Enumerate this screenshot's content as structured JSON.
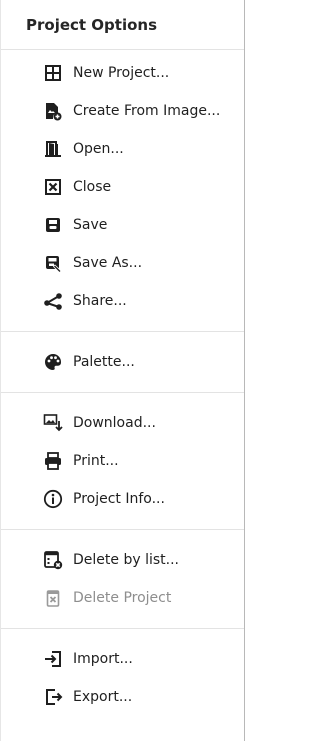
{
  "menu": {
    "title": "Project Options",
    "sections": [
      [
        {
          "label": "New Project...",
          "icon": "grid-icon",
          "enabled": true
        },
        {
          "label": "Create From Image...",
          "icon": "image-file-plus-icon",
          "enabled": true
        },
        {
          "label": "Open...",
          "icon": "door-open-icon",
          "enabled": true
        },
        {
          "label": "Close",
          "icon": "close-box-icon",
          "enabled": true
        },
        {
          "label": "Save",
          "icon": "save-icon",
          "enabled": true
        },
        {
          "label": "Save As...",
          "icon": "save-as-icon",
          "enabled": true
        },
        {
          "label": "Share...",
          "icon": "share-icon",
          "enabled": true
        }
      ],
      [
        {
          "label": "Palette...",
          "icon": "palette-icon",
          "enabled": true
        }
      ],
      [
        {
          "label": "Download...",
          "icon": "download-image-icon",
          "enabled": true
        },
        {
          "label": "Print...",
          "icon": "printer-icon",
          "enabled": true
        },
        {
          "label": "Project Info...",
          "icon": "info-icon",
          "enabled": true
        }
      ],
      [
        {
          "label": "Delete by list...",
          "icon": "delete-list-icon",
          "enabled": true
        },
        {
          "label": "Delete Project",
          "icon": "delete-project-icon",
          "enabled": false
        }
      ],
      [
        {
          "label": "Import...",
          "icon": "import-icon",
          "enabled": true
        },
        {
          "label": "Export...",
          "icon": "export-icon",
          "enabled": true
        }
      ]
    ]
  },
  "colors": {
    "text": "#1f1f1f",
    "disabled_text": "#8e8e8e",
    "icon": "#1f1f1f",
    "disabled_icon": "#9a9a9a",
    "separator": "#e3e3e3"
  }
}
